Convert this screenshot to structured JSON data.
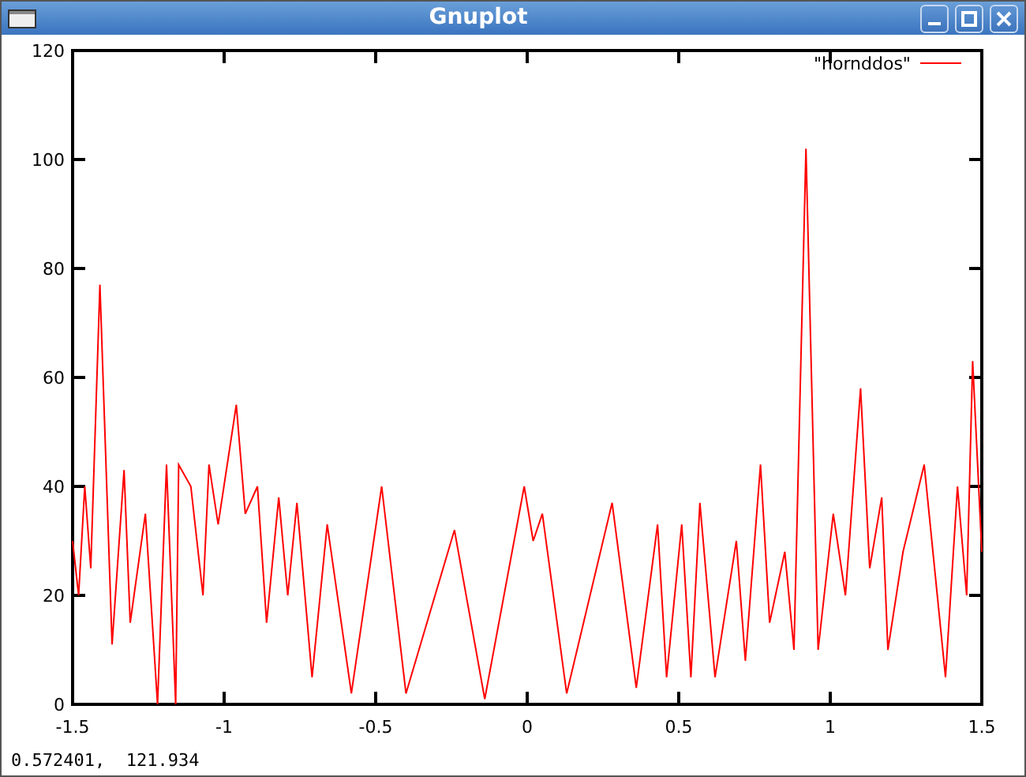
{
  "window": {
    "title": "Gnuplot"
  },
  "plot": {
    "chart_data": {
      "type": "line",
      "xlim": [
        -1.5,
        1.5
      ],
      "ylim": [
        0,
        120
      ],
      "xticks": [
        -1.5,
        -1,
        -0.5,
        0,
        0.5,
        1,
        1.5
      ],
      "yticks": [
        0,
        20,
        40,
        60,
        80,
        100,
        120
      ],
      "x": [
        -1.5,
        -1.48,
        -1.46,
        -1.44,
        -1.41,
        -1.37,
        -1.33,
        -1.31,
        -1.26,
        -1.22,
        -1.19,
        -1.16,
        -1.15,
        -1.11,
        -1.07,
        -1.05,
        -1.02,
        -0.96,
        -0.93,
        -0.89,
        -0.86,
        -0.82,
        -0.79,
        -0.76,
        -0.71,
        -0.66,
        -0.58,
        -0.48,
        -0.4,
        -0.24,
        -0.14,
        -0.01,
        0.02,
        0.05,
        0.13,
        0.28,
        0.36,
        0.43,
        0.46,
        0.51,
        0.54,
        0.57,
        0.62,
        0.69,
        0.72,
        0.77,
        0.8,
        0.85,
        0.88,
        0.92,
        0.96,
        1.01,
        1.05,
        1.1,
        1.13,
        1.17,
        1.19,
        1.24,
        1.31,
        1.38,
        1.42,
        1.45,
        1.47,
        1.5
      ],
      "series": [
        {
          "name": "\"hornddos\"",
          "color": "#ff0000",
          "values": [
            30,
            20,
            40,
            25,
            77,
            11,
            43,
            15,
            35,
            0,
            44,
            0,
            44,
            40,
            20,
            44,
            33,
            55,
            35,
            40,
            15,
            38,
            20,
            37,
            5,
            33,
            2,
            40,
            2,
            32,
            1,
            40,
            30,
            35,
            2,
            37,
            3,
            33,
            5,
            33,
            5,
            37,
            5,
            30,
            8,
            44,
            15,
            28,
            10,
            102,
            10,
            35,
            20,
            58,
            25,
            38,
            10,
            28,
            44,
            5,
            40,
            20,
            63,
            28
          ]
        }
      ]
    }
  },
  "status_bar": {
    "text": "0.572401,  121.934"
  }
}
